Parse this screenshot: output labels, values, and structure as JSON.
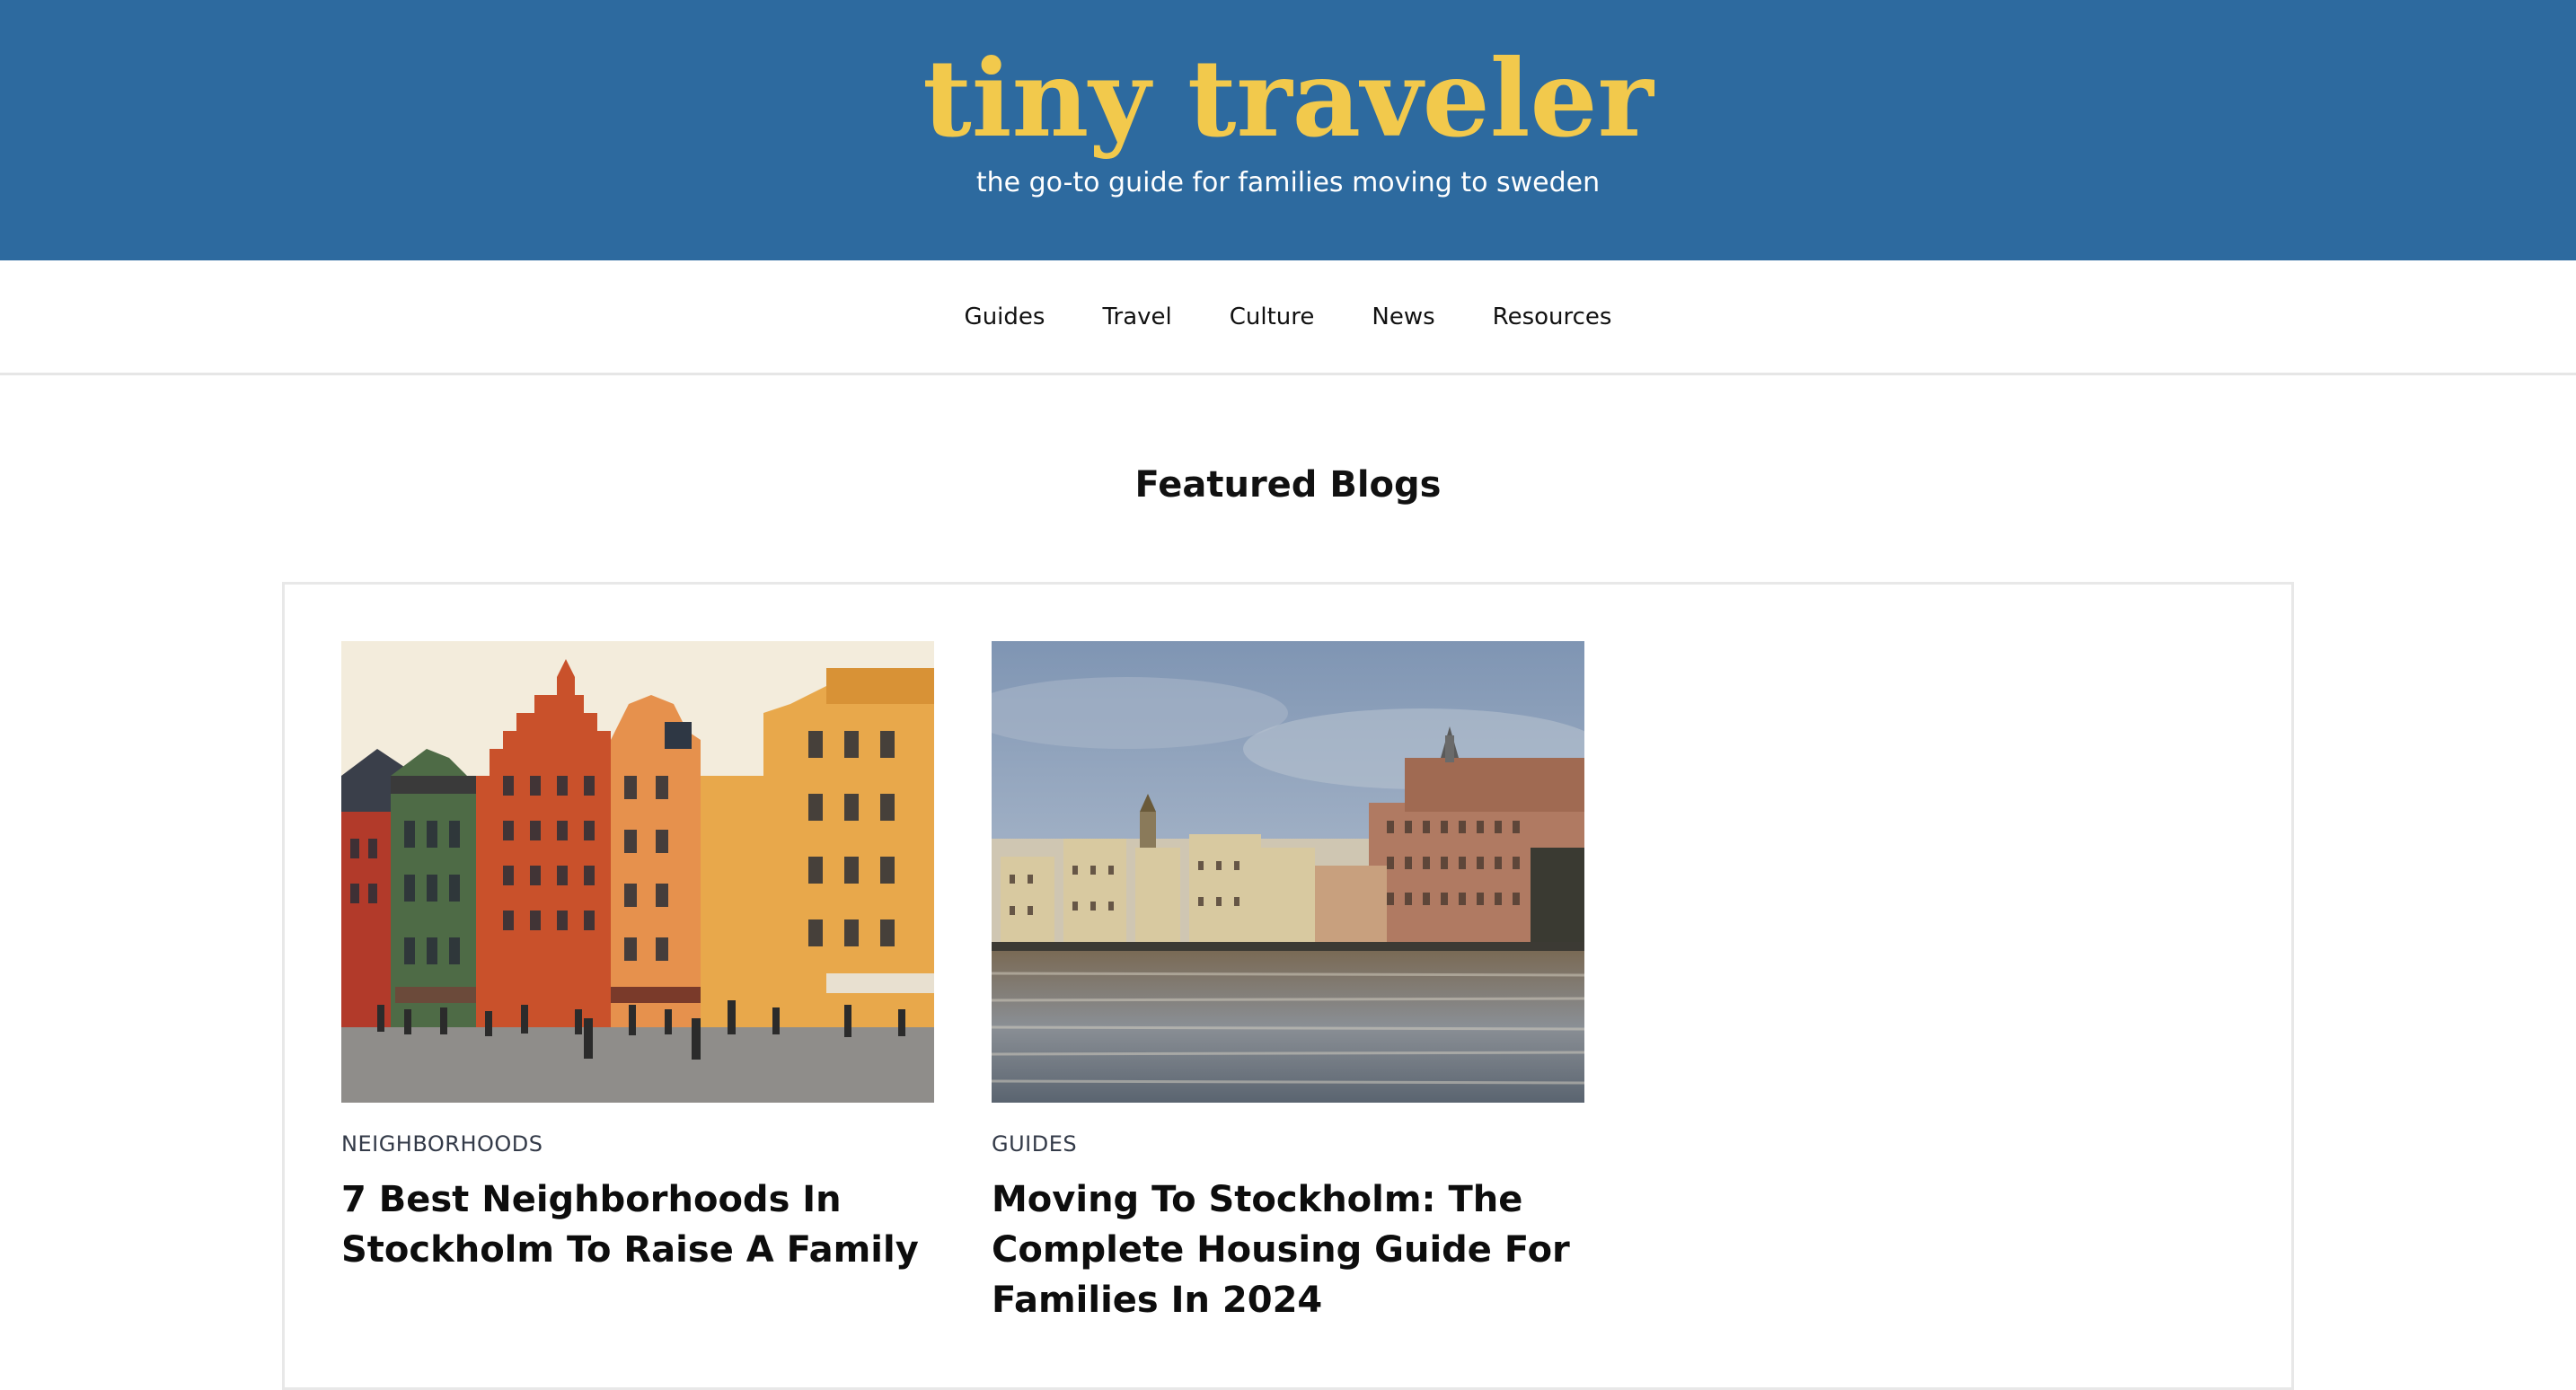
{
  "header": {
    "logo": "tiny traveler",
    "tagline": "the go-to guide for families moving to sweden"
  },
  "nav": {
    "items": [
      {
        "label": "Guides"
      },
      {
        "label": "Travel"
      },
      {
        "label": "Culture"
      },
      {
        "label": "News"
      },
      {
        "label": "Resources"
      }
    ]
  },
  "featured": {
    "title": "Featured Blogs",
    "posts": [
      {
        "category": "NEIGHBORHOODS",
        "title": "7 Best Neighborhoods In Stockholm To Raise A Family",
        "image": "colorful-stockholm-old-town-buildings-photo"
      },
      {
        "category": "GUIDES",
        "title": "Moving To Stockholm: The Complete Housing Guide For Families In 2024",
        "image": "stockholm-waterfront-skyline-photo"
      }
    ]
  },
  "colors": {
    "header_bg": "#2d6a9f",
    "logo": "#f2c94c",
    "tagline": "#ffffff",
    "text": "#111111"
  }
}
